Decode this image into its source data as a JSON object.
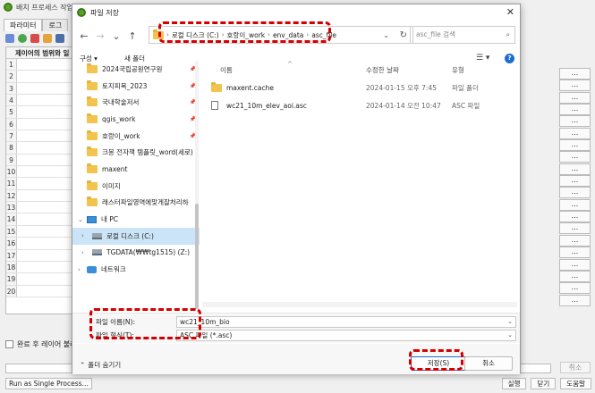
{
  "background_window": {
    "title": "배치 프로세스 작업 ",
    "tabs": [
      "파라미터",
      "로그"
    ],
    "table_header": "제이어의 범위와 일",
    "row_numbers": [
      "1",
      "2",
      "3",
      "4",
      "5",
      "6",
      "7",
      "8",
      "9",
      "10",
      "11",
      "12",
      "13",
      "14",
      "15",
      "16",
      "17",
      "18",
      "19",
      "20"
    ],
    "row_button_label": "...",
    "load_layers_checkbox": "완료 후 레이어 불러",
    "cancel_label": "취소",
    "batch_button": "Run as Single Process…",
    "footer_buttons": [
      "실행",
      "닫기",
      "도움말"
    ]
  },
  "dialog": {
    "title": "파일 저장",
    "close_label": "✕",
    "nav": {
      "back": "←",
      "forward": "→",
      "recent": "⌄",
      "up": "↑"
    },
    "breadcrumbs": [
      "로컬 디스크 (C:)",
      "호랑이_work",
      "env_data",
      "asc_file"
    ],
    "search_placeholder": "asc_file 검색",
    "organize_label": "구성 ▾",
    "new_folder_label": "새 폴더",
    "sidebar": [
      {
        "label": "2024국립공원연구원",
        "pinned": true
      },
      {
        "label": "토지피복_2023",
        "pinned": true
      },
      {
        "label": "국내학술저서",
        "pinned": true
      },
      {
        "label": "qgis_work",
        "pinned": true
      },
      {
        "label": "호랑이_work",
        "pinned": true
      },
      {
        "label": "크몽 전자책 템플릿_word(세로)",
        "pinned": false
      },
      {
        "label": "maxent",
        "pinned": false
      },
      {
        "label": "이미지",
        "pinned": false
      },
      {
        "label": "래스터파일영역에맞게잘처리하",
        "pinned": false
      }
    ],
    "this_pc_label": "내 PC",
    "local_disk_label": "로컬 디스크 (C:)",
    "network_drive_label": "TGDATA(₩₩tg1515) (Z:)",
    "network_label": "네트워크",
    "columns": {
      "name": "이름",
      "date": "수정한 날짜",
      "type": "유형"
    },
    "files": [
      {
        "name": "maxent.cache",
        "date": "2024-01-15 오후 7:45",
        "type": "파일 폴더",
        "icon": "folder"
      },
      {
        "name": "wc21_10m_elev_aoi.asc",
        "date": "2024-01-14 오전 10:47",
        "type": "ASC 파일",
        "icon": "document"
      }
    ],
    "filename_label": "파일 이름(N):",
    "filename_value": "wc21_10m_bio",
    "filetype_label": "파일 형식(T):",
    "filetype_value": "ASC 파일 (*.asc)",
    "hide_folders_label": "폴더 숨기기",
    "save_label": "저장(S)",
    "cancel_label": "취소"
  },
  "colors": {
    "annotation": "#d40000",
    "accent": "#1d6fce",
    "folder": "#f3c34f"
  }
}
